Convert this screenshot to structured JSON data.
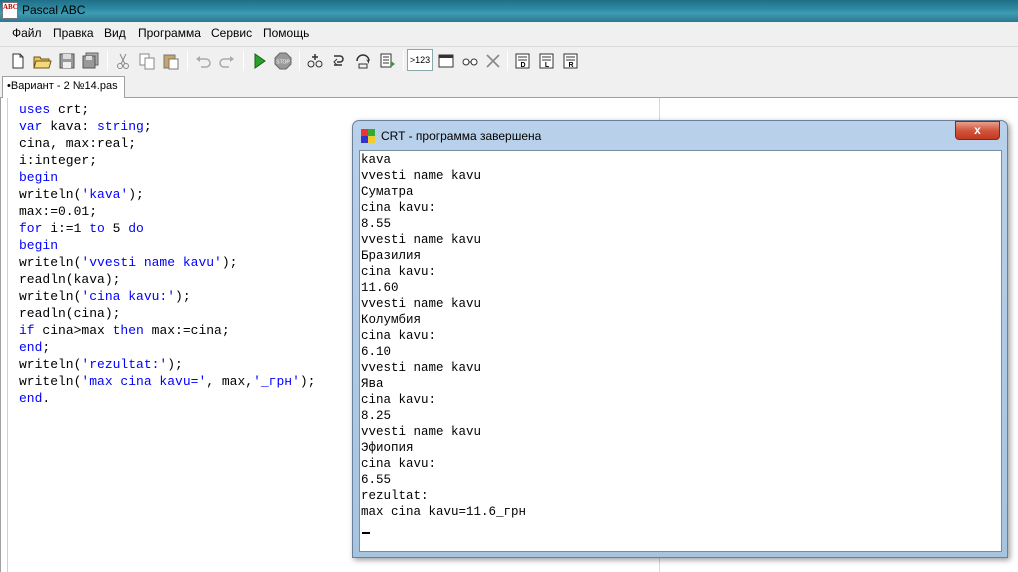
{
  "app": {
    "title": "Pascal ABC",
    "icon_letters": "ABC"
  },
  "menu": [
    "Файл",
    "Правка",
    "Вид",
    "Программа",
    "Сервис",
    "Помощь"
  ],
  "toolbar": {
    "icons": [
      "new-file-icon",
      "open-folder-icon",
      "save-icon",
      "save-all-icon",
      "cut-icon",
      "copy-icon",
      "paste-icon",
      "undo-icon",
      "redo-icon",
      "run-icon",
      "stop-icon",
      "add-watch-icon",
      "step-into-icon",
      "step-over-icon",
      "run-to-cursor-icon",
      "output-123-icon",
      "window-icon",
      "watch-glasses-icon",
      "clear-icon",
      "compile-icon",
      "build-icon",
      "rebuild-icon"
    ],
    "output_label": ">123"
  },
  "tab": {
    "label": "•Вариант - 2  №14.pas"
  },
  "editor": {
    "lines": [
      [
        {
          "t": "uses",
          "k": 1
        },
        {
          "t": " crt;"
        }
      ],
      [
        {
          "t": "var",
          "k": 1
        },
        {
          "t": " kava: "
        },
        {
          "t": "string",
          "k": 1
        },
        {
          "t": ";"
        }
      ],
      [
        {
          "t": "cina, max:real;"
        }
      ],
      [
        {
          "t": "i:integer;"
        }
      ],
      [
        {
          "t": "begin",
          "k": 1
        }
      ],
      [
        {
          "t": "writeln("
        },
        {
          "t": "'kava'",
          "s": 1
        },
        {
          "t": ");"
        }
      ],
      [
        {
          "t": "max:=0.01;"
        }
      ],
      [
        {
          "t": "for",
          "k": 1
        },
        {
          "t": " i:=1 "
        },
        {
          "t": "to",
          "k": 1
        },
        {
          "t": " 5 "
        },
        {
          "t": "do",
          "k": 1
        }
      ],
      [
        {
          "t": "begin",
          "k": 1
        }
      ],
      [
        {
          "t": "writeln("
        },
        {
          "t": "'vvesti name kavu'",
          "s": 1
        },
        {
          "t": ");"
        }
      ],
      [
        {
          "t": "readln(kava);"
        }
      ],
      [
        {
          "t": "writeln("
        },
        {
          "t": "'cina kavu:'",
          "s": 1
        },
        {
          "t": ");"
        }
      ],
      [
        {
          "t": "readln(cina);"
        }
      ],
      [
        {
          "t": "if",
          "k": 1
        },
        {
          "t": " cina>max "
        },
        {
          "t": "then",
          "k": 1
        },
        {
          "t": " max:=cina;"
        }
      ],
      [
        {
          "t": "end",
          "k": 1
        },
        {
          "t": ";"
        }
      ],
      [
        {
          "t": "writeln("
        },
        {
          "t": "'rezultat:'",
          "s": 1
        },
        {
          "t": ");"
        }
      ],
      [
        {
          "t": "writeln("
        },
        {
          "t": "'max cina kavu='",
          "s": 1
        },
        {
          "t": ", max,"
        },
        {
          "t": "'_грн'",
          "s": 1
        },
        {
          "t": ");"
        }
      ],
      [
        {
          "t": "end",
          "k": 1
        },
        {
          "t": "."
        }
      ]
    ]
  },
  "crt": {
    "title": "CRT - программа завершена",
    "close_label": "x",
    "output": [
      "kava",
      "vvesti name kavu",
      "Суматра",
      "cina kavu:",
      "8.55",
      "vvesti name kavu",
      "Бразилия",
      "cina kavu:",
      "11.60",
      "vvesti name kavu",
      "Колумбия",
      "cina kavu:",
      "6.10",
      "vvesti name kavu",
      "Ява",
      "cina kavu:",
      "8.25",
      "vvesti name kavu",
      "Эфиопия",
      "cina kavu:",
      "6.55",
      "rezultat:",
      "max cina kavu=11.6_грн"
    ]
  }
}
